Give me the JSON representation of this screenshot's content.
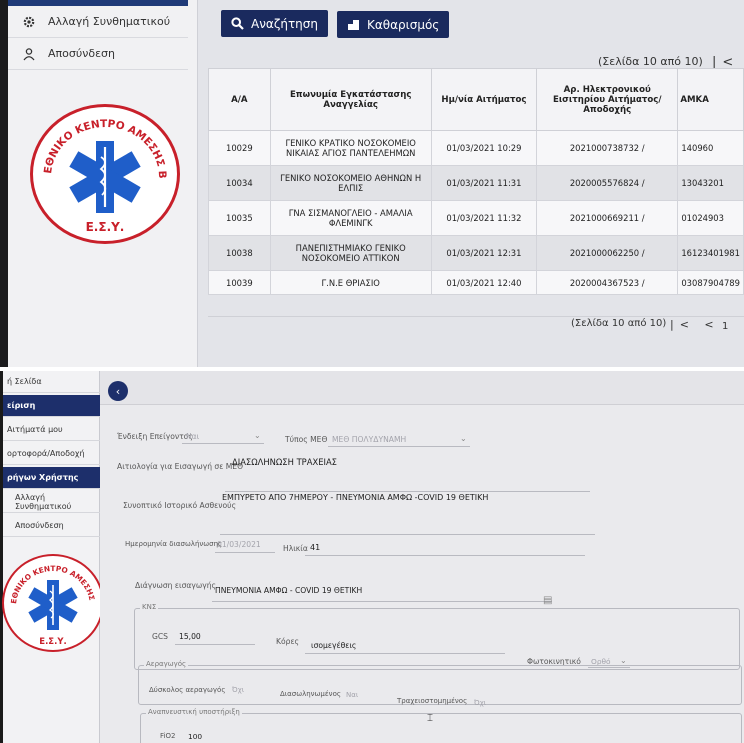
{
  "top": {
    "sidebar": {
      "items": [
        {
          "label": "Αλλαγή Συνθηματικού",
          "icon": "gear-icon"
        },
        {
          "label": "Αποσύνδεση",
          "icon": "user-icon"
        }
      ]
    },
    "logo": {
      "ring_text": "ΕΘΝΙΚΟ ΚΕΝΤΡΟ ΑΜΕΣΗΣ ΒΟΗΘΕΙΑΣ",
      "bottom_text": "Ε.Σ.Υ.",
      "colors": {
        "ring": "#c8202a",
        "star": "#1f5ec9"
      }
    },
    "toolbar": {
      "search_label": "Αναζήτηση",
      "clear_label": "Καθαρισμός"
    },
    "pager": {
      "text_top": "(Σελίδα 10 από 10)",
      "text_bottom": "(Σελίδα 10 από 10)",
      "first_page": "1"
    },
    "table": {
      "headers": [
        "Α/Α",
        "Επωνυμία Εγκατάστασης Αναγγελίας",
        "Ημ/νία Αιτήματος",
        "Αρ. Ηλεκτρονικού Εισιτηρίου Αιτήματος/ Αποδοχής",
        "ΑΜΚΑ"
      ],
      "rows": [
        {
          "aa": "10029",
          "facility": "ΓΕΝΙΚΟ ΚΡΑΤΙΚΟ ΝΟΣΟΚΟΜΕΙΟ ΝΙΚΑΙΑΣ ΑΓΙΟΣ ΠΑΝΤΕΛΕΗΜΩΝ",
          "date": "01/03/2021 10:29",
          "ticket": "2021000738732 /",
          "amka": "140960"
        },
        {
          "aa": "10034",
          "facility": "ΓΕΝΙΚΟ ΝΟΣΟΚΟΜΕΙΟ ΑΘΗΝΩΝ Η ΕΛΠΙΣ",
          "date": "01/03/2021 11:31",
          "ticket": "2020005576824 /",
          "amka": "13043201"
        },
        {
          "aa": "10035",
          "facility": "ΓΝΑ ΣΙΣΜΑΝΟΓΛΕΙΟ - ΑΜΑΛΙΑ ΦΛΕΜΙΝΓΚ",
          "date": "01/03/2021 11:32",
          "ticket": "2021000669211 /",
          "amka": "01024903"
        },
        {
          "aa": "10038",
          "facility": "ΠΑΝΕΠΙΣΤΗΜΙΑΚΟ ΓΕΝΙΚΟ ΝΟΣΟΚΟΜΕΙΟ ΑΤΤΙΚΟΝ",
          "date": "01/03/2021 12:31",
          "ticket": "2021000062250 /",
          "amka": "16123401981"
        },
        {
          "aa": "10039",
          "facility": "Γ.Ν.Ε ΘΡΙΑΣΙΟ",
          "date": "01/03/2021 12:40",
          "ticket": "2020004367523 /",
          "amka": "03087904789"
        }
      ]
    }
  },
  "bottom": {
    "sidebar": {
      "items": [
        "ή Σελίδα",
        "είριση",
        "Αιτήματά μου",
        "ορτοφορά/Αποδοχή",
        "ρήγων Χρήστης",
        "Αλλαγή Συνθηματικού",
        "Αποσύνδεση"
      ]
    },
    "form": {
      "indication_label": "Ένδειξη Επείγοντος",
      "indication_value": "Ναι",
      "icu_type_label": "Τύπος ΜΕΘ",
      "icu_type_value": "ΜΕΘ ΠΟΛΥΔΥΝΑΜΗ",
      "reason_label": "Αιτιολογία για Εισαγωγή σε ΜΕΘ",
      "reason_value": "ΔΙΑΣΩΛΗΝΩΣΗ ΤΡΑΧΕΙΑΣ",
      "history_label": "Συνοπτικό Ιστορικό Ασθενούς",
      "history_value": "ΕΜΠΥΡΕΤΟ ΑΠΟ 7ΗΜΕΡΟΥ - ΠΝΕΥΜΟΝΙΑ ΑΜΦΩ -COVID 19 ΘΕΤΙΚΗ",
      "intubation_date_label": "Ημερομηνία διασωλήνωσης",
      "intubation_date_value": "01/03/2021",
      "age_label": "Ηλικία",
      "age_value": "41",
      "diagnosis_label": "Διάγνωση εισαγωγής",
      "diagnosis_value": "ΠΝΕΥΜΟΝΙΑ ΑΜΦΩ - COVID 19 ΘΕΤΙΚΗ",
      "kns_legend": "ΚΝΣ",
      "gcs_label": "GCS",
      "gcs_value": "15,00",
      "pupils_label": "Κόρες",
      "pupils_value": "ισομεγέθεις",
      "photokinetic_label": "Φωτοκινητικό",
      "photokinetic_value": "Ορθό",
      "airway_legend": "Αεραγωγός",
      "difficult_airway_label": "Δύσκολος αεραγωγός",
      "difficult_airway_value": "Όχι",
      "intubated_label": "Διασωληνωμένος",
      "intubated_value": "Ναι",
      "tracheostomy_label": "Τραχειοστομημένος",
      "tracheostomy_value": "Όχι",
      "resp_legend": "Αναπνευστική υποστήριξη",
      "fio2_label": "FiO2",
      "fio2_value": "100"
    }
  }
}
